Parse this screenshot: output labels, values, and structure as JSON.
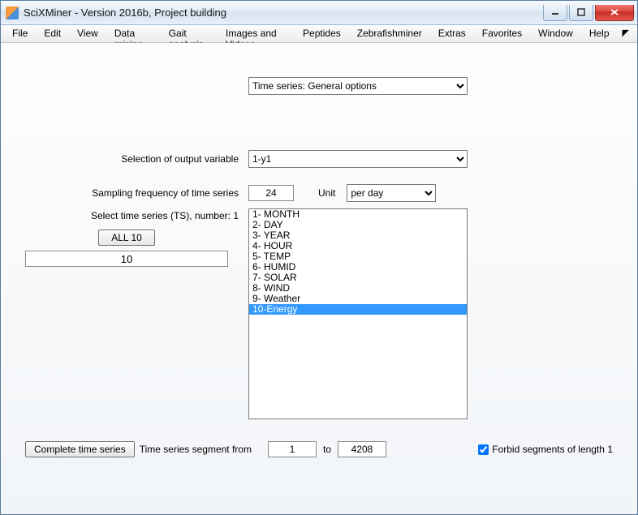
{
  "window": {
    "title": "SciXMiner - Version 2016b, Project building"
  },
  "menu": {
    "items": [
      "File",
      "Edit",
      "View",
      "Data mining",
      "Gait analysis",
      "Images and Videos",
      "Peptides",
      "Zebrafishminer",
      "Extras",
      "Favorites",
      "Window",
      "Help"
    ]
  },
  "panel": {
    "section_select_value": "Time series: General options",
    "output_var_label": "Selection of output variable",
    "output_var_value": "1-y1",
    "sampling_label": "Sampling frequency of time series",
    "sampling_value": "24",
    "unit_label": "Unit",
    "unit_value": "per day",
    "ts_label": "Select time series (TS), number: 1",
    "ts_items": [
      {
        "text": "1- MONTH",
        "selected": false
      },
      {
        "text": "2- DAY",
        "selected": false
      },
      {
        "text": "3- YEAR",
        "selected": false
      },
      {
        "text": "4- HOUR",
        "selected": false
      },
      {
        "text": "5- TEMP",
        "selected": false
      },
      {
        "text": "6- HUMID",
        "selected": false
      },
      {
        "text": "7- SOLAR",
        "selected": false
      },
      {
        "text": "8- WIND",
        "selected": false
      },
      {
        "text": "9- Weather",
        "selected": false
      },
      {
        "text": "10-Energy",
        "selected": true
      }
    ],
    "all_btn": "ALL 10",
    "count_value": "10",
    "complete_btn": "Complete time series",
    "segment_label": "Time series segment from",
    "segment_from": "1",
    "segment_to_label": "to",
    "segment_to": "4208",
    "forbid_label": "Forbid segments of length 1",
    "forbid_checked": true
  }
}
